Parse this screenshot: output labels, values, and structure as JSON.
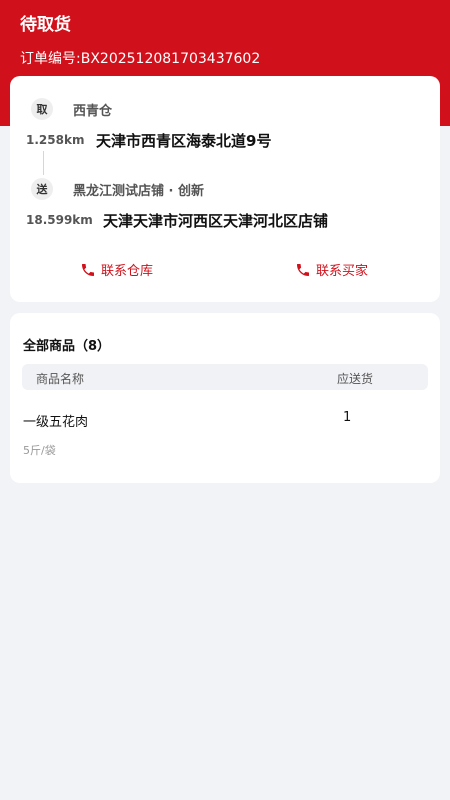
{
  "header": {
    "status": "待取货",
    "order_no": "订单编号:BX202512081703437602"
  },
  "route": {
    "pickup": {
      "badge": "取",
      "name": "西青仓",
      "distance": "1.258km",
      "address": "天津市西青区海泰北道9号"
    },
    "delivery": {
      "badge": "送",
      "name": "黑龙江测试店铺 · 创新",
      "distance": "18.599km",
      "address": "天津天津市河西区天津河北区店铺"
    },
    "contact_warehouse": "联系仓库",
    "contact_buyer": "联系买家",
    "icon": "phone-icon",
    "accent_color": "#d0111b"
  },
  "goods": {
    "title": "全部商品（8）",
    "columns": {
      "name": "商品名称",
      "qty": "应送货"
    },
    "items": [
      {
        "name": "一级五花肉",
        "qty": "1",
        "spec": "5斤/袋"
      }
    ]
  }
}
